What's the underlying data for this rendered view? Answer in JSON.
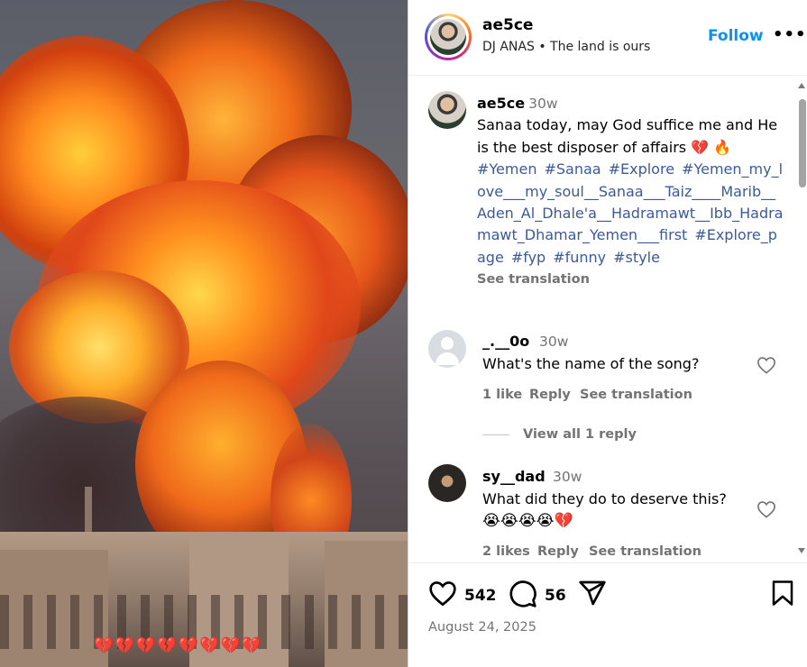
{
  "post": {
    "username": "ae5ce",
    "audio_line": "DJ ANAS • The land is ours",
    "follow_label": "Follow",
    "more_label": "•••",
    "video_overlay_text": "💔💔💔💔💔💔💔💔"
  },
  "caption": {
    "username": "ae5ce",
    "time": "30w",
    "text": "Sanaa today, may God suffice me and He is the best disposer of affairs 💔 🔥",
    "hashtags": [
      "#Yemen",
      "#Sanaa",
      "#Explore",
      "#Yemen_my_love___my_soul__Sanaa___Taiz____Marib__Aden_Al_Dhale'a__Hadramawt__Ibb_Hadramawt_Dhamar_Yemen___first",
      "#Explore_page",
      "#fyp",
      "#funny",
      "#style"
    ],
    "see_translation": "See translation"
  },
  "comments": [
    {
      "username": "_.__0o",
      "time": "30w",
      "text": "What's the name of the song?",
      "likes": "1 like",
      "reply": "Reply",
      "see_translation": "See translation",
      "view_replies": "View all 1 reply"
    },
    {
      "username": "sy__dad",
      "time": "30w",
      "text": "What did they do to deserve this?",
      "emoji_line": "😭😭😭😭💔",
      "likes": "2 likes",
      "reply": "Reply",
      "see_translation": "See translation"
    }
  ],
  "actions": {
    "like_count": "542",
    "comment_count": "56",
    "date": "August 24, 2025"
  },
  "colors": {
    "link_blue": "#0095f6",
    "hashtag": "#3c5a9a",
    "muted": "#737373"
  },
  "icons": [
    "more-icon",
    "heart-icon",
    "comment-icon",
    "share-icon",
    "bookmark-icon",
    "small-heart-icon",
    "default-avatar-icon"
  ]
}
